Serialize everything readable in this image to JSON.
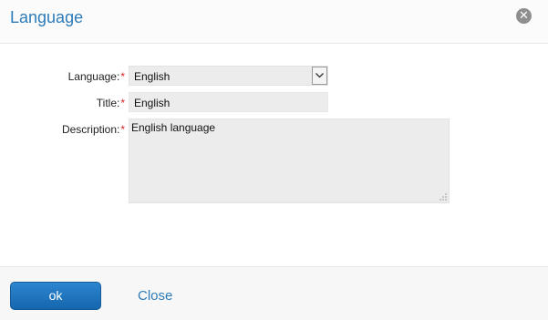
{
  "dialog": {
    "title": "Language",
    "close_icon": "close-circle-icon"
  },
  "form": {
    "language": {
      "label": "Language:",
      "required_mark": "*",
      "value": "English"
    },
    "title": {
      "label": "Title:",
      "required_mark": "*",
      "value": "English"
    },
    "description": {
      "label": "Description:",
      "required_mark": "*",
      "value": "English language"
    }
  },
  "footer": {
    "ok_label": "ok",
    "close_label": "Close"
  },
  "colors": {
    "accent": "#2d7bb9",
    "required": "#dd2222",
    "button": "#1f75c0"
  }
}
